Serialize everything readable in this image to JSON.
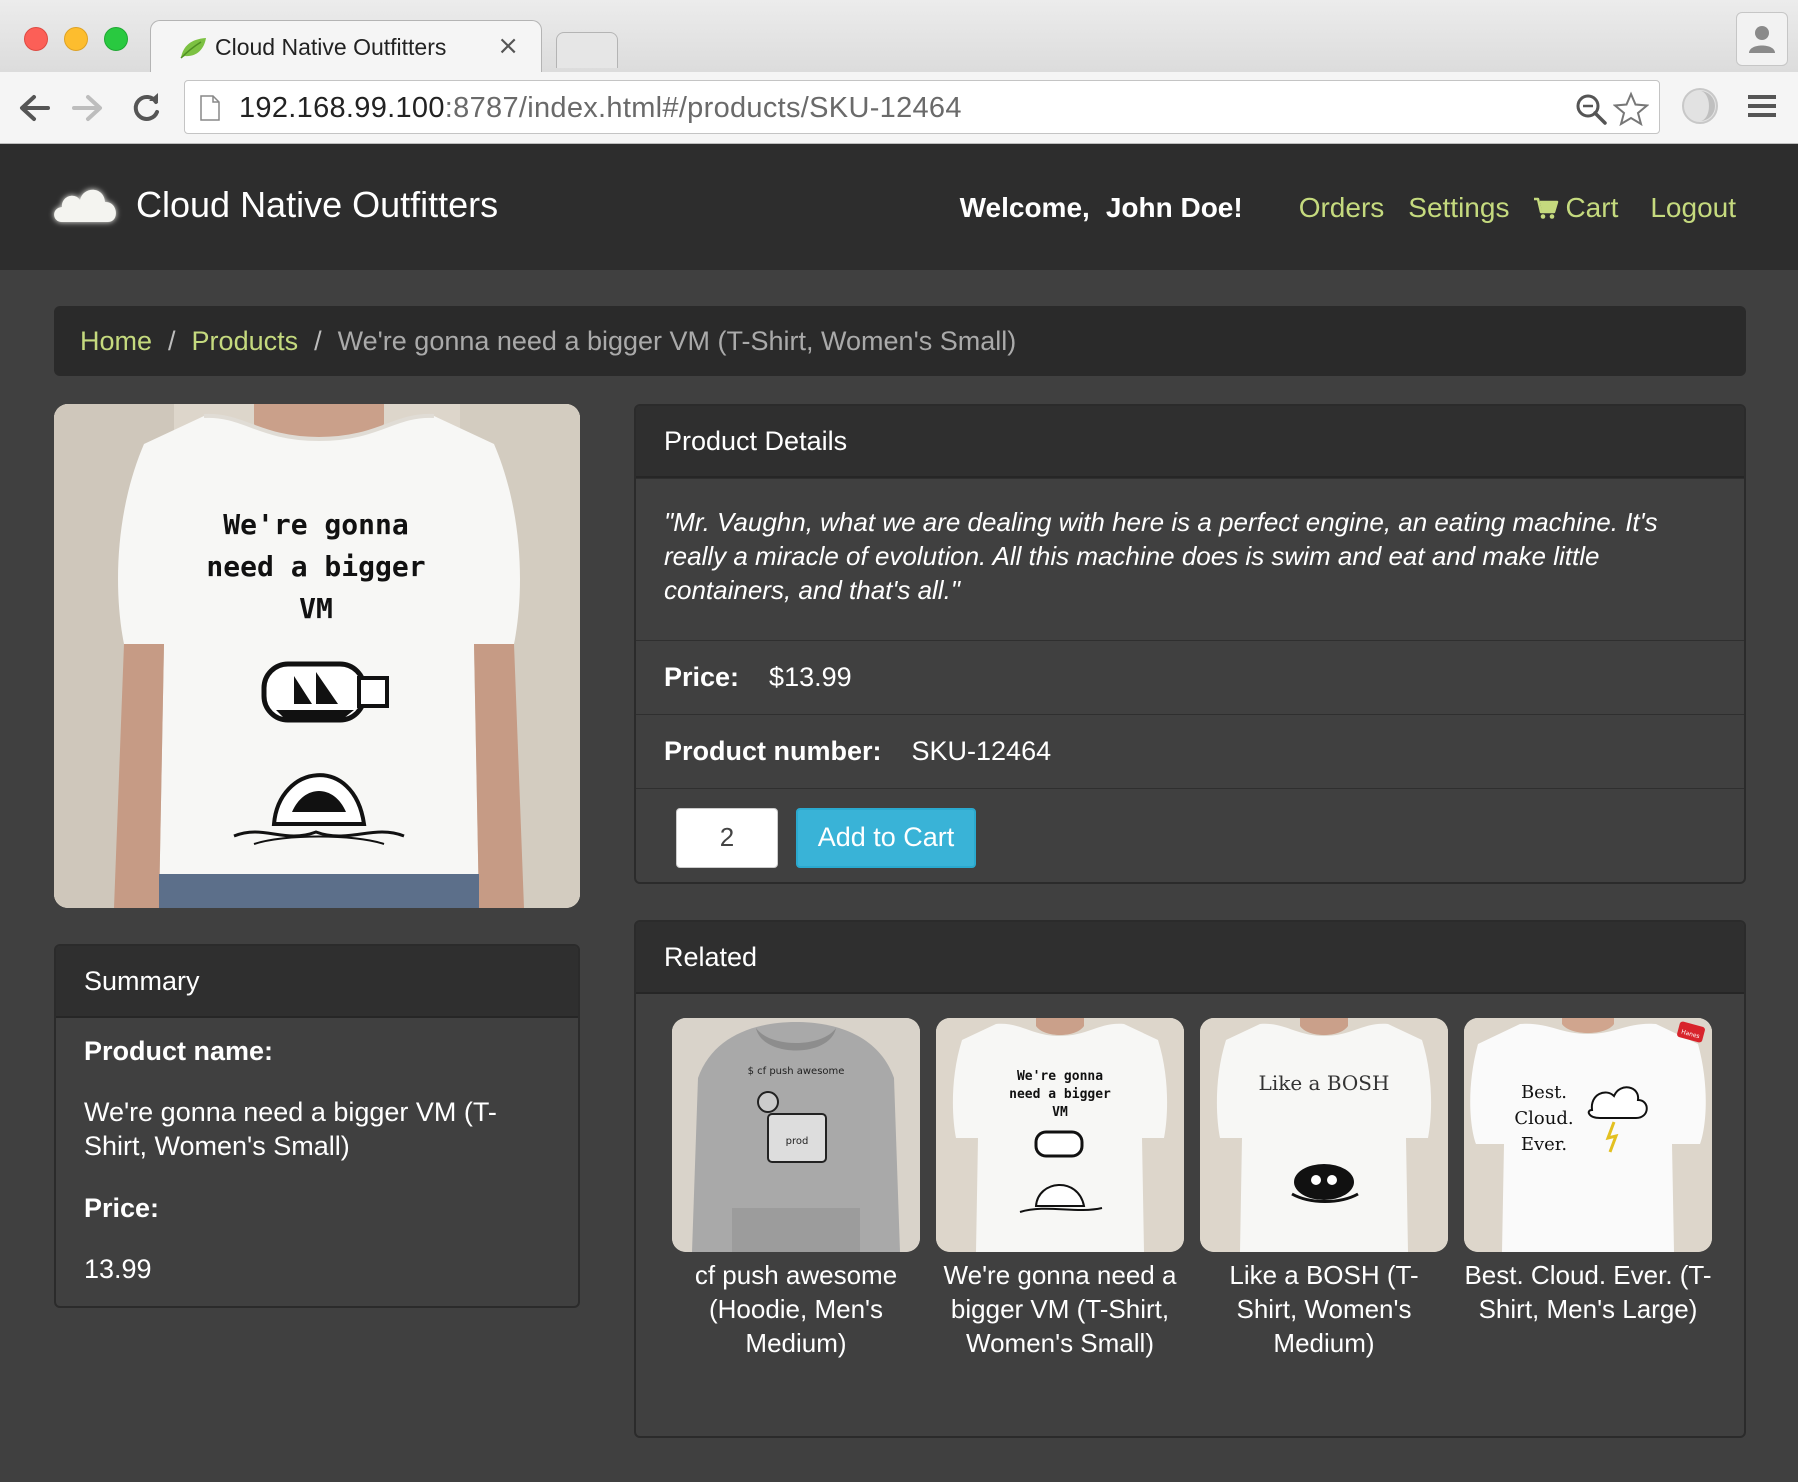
{
  "browser": {
    "tab_title": "Cloud Native Outfitters",
    "tab_close": "×",
    "url_host": "192.168.99.100",
    "url_rest": ":8787/index.html#/products/SKU-12464"
  },
  "navbar": {
    "brand": "Cloud Native Outfitters",
    "welcome": "Welcome,",
    "user": "John Doe!",
    "links": {
      "orders": "Orders",
      "settings": "Settings",
      "cart": "Cart",
      "logout": "Logout"
    },
    "link_color": "#c5da7e"
  },
  "breadcrumb": {
    "home": "Home",
    "products": "Products",
    "separator": "/",
    "current": "We're gonna need a bigger VM (T-Shirt, Women's Small)"
  },
  "product_image": {
    "shirt_text_line1": "We're gonna",
    "shirt_text_line2": "need a bigger",
    "shirt_text_line3": "VM"
  },
  "details": {
    "heading": "Product Details",
    "description": "\"Mr. Vaughn, what we are dealing with here is a perfect engine, an eating machine. It's really a miracle of evolution. All this machine does is swim and eat and make little containers, and that's all.\"",
    "price_label": "Price:",
    "price_value": "$13.99",
    "number_label": "Product number:",
    "number_value": "SKU-12464",
    "quantity": "2",
    "add_to_cart": "Add to Cart",
    "button_color": "#39b3d7"
  },
  "summary": {
    "heading": "Summary",
    "name_label": "Product name:",
    "name_value": "We're gonna need a bigger VM (T-Shirt, Women's Small)",
    "price_label": "Price:",
    "price_value": "13.99"
  },
  "related": {
    "heading": "Related",
    "items": [
      {
        "label": "cf push awesome (Hoodie, Men's Medium)",
        "shirt_text": "$ cf push awesome",
        "badge": "prod"
      },
      {
        "label": "We're gonna need a bigger VM (T-Shirt, Women's Small)",
        "shirt_text_line1": "We're gonna",
        "shirt_text_line2": "need a bigger",
        "shirt_text_line3": "VM"
      },
      {
        "label": "Like a BOSH (T-Shirt, Women's Medium)",
        "shirt_text": "Like a BOSH"
      },
      {
        "label": "Best. Cloud. Ever. (T-Shirt, Men's Large)",
        "shirt_text_line1": "Best.",
        "shirt_text_line2": "Cloud.",
        "shirt_text_line3": "Ever.",
        "tag": "Hanes"
      }
    ]
  }
}
